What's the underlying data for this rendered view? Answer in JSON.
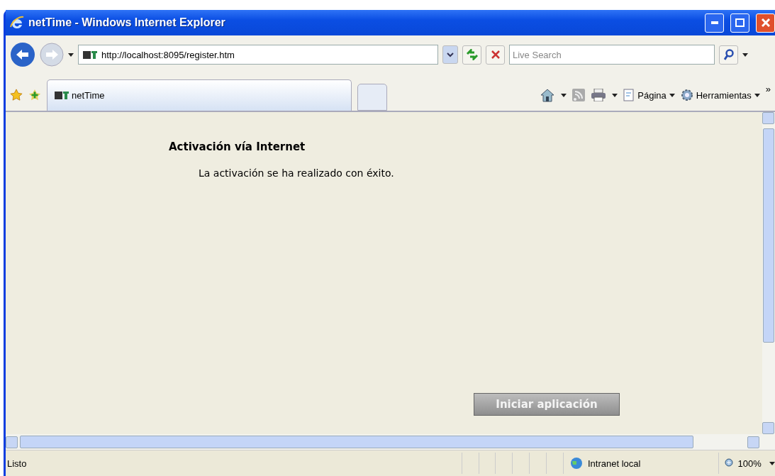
{
  "window": {
    "title": "netTime - Windows Internet Explorer"
  },
  "address_bar": {
    "url": "http://localhost:8095/register.htm"
  },
  "search": {
    "placeholder": "Live Search"
  },
  "tab": {
    "label": "netTime",
    "selected": true
  },
  "command_bar": [
    {
      "label": "Página"
    },
    {
      "label": "Herramientas"
    }
  ],
  "overflow": "»",
  "page": {
    "heading": "Activación vía Internet",
    "message": "La activación se ha realizado con éxito.",
    "button": "Iniciar aplicación"
  },
  "status_bar": {
    "status": "Listo",
    "zone": "Intranet local",
    "zoom": "100%"
  }
}
